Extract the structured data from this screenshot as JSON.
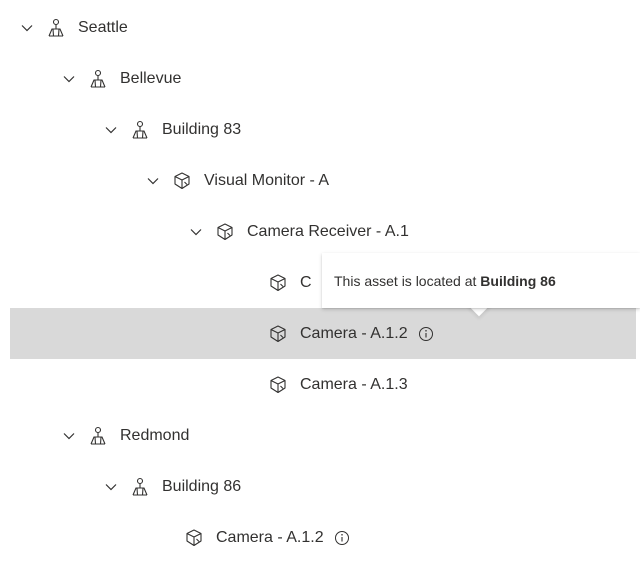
{
  "tree": {
    "nodes": [
      {
        "label": "Seattle",
        "type": "location",
        "expanded": true,
        "level": 0
      },
      {
        "label": "Bellevue",
        "type": "location",
        "expanded": true,
        "level": 1
      },
      {
        "label": "Building 83",
        "type": "location",
        "expanded": true,
        "level": 2
      },
      {
        "label": "Visual Monitor - A",
        "type": "asset",
        "expanded": true,
        "level": 3
      },
      {
        "label": "Camera Receiver - A.1",
        "type": "asset",
        "expanded": true,
        "level": 4
      },
      {
        "label": "C",
        "type": "asset",
        "level": 5
      },
      {
        "label": "Camera - A.1.2",
        "type": "asset",
        "level": 5,
        "selected": true,
        "info": true
      },
      {
        "label": "Camera - A.1.3",
        "type": "asset",
        "level": 5
      },
      {
        "label": "Redmond",
        "type": "location",
        "expanded": true,
        "level": 1
      },
      {
        "label": "Building 86",
        "type": "location",
        "expanded": true,
        "level": 2
      },
      {
        "label": "Camera - A.1.2",
        "type": "asset",
        "level": 3,
        "info": true
      }
    ]
  },
  "tooltip": {
    "prefix": "This asset is located at ",
    "location": "Building 86"
  },
  "colors": {
    "selected_row": "#d9d9d9",
    "text": "#323130",
    "icon": "#323130"
  }
}
